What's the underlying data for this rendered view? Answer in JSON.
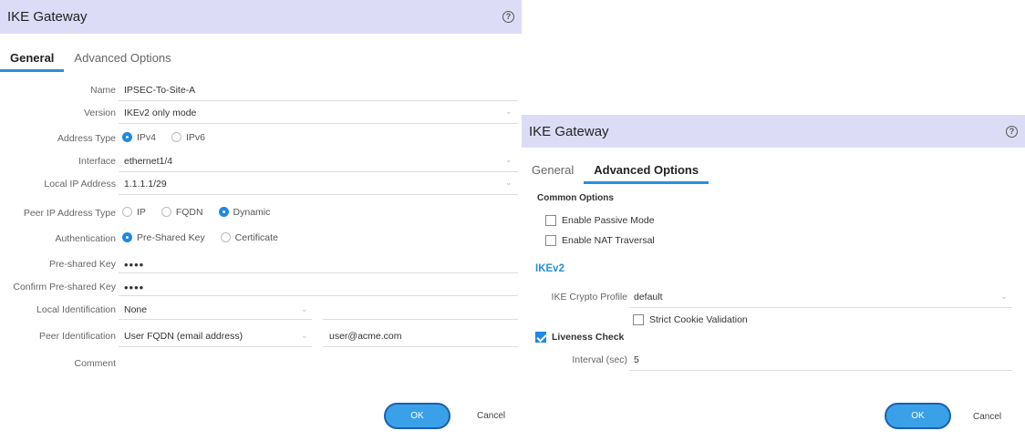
{
  "dialog1": {
    "title": "IKE Gateway",
    "help_symbol": "?",
    "tabs": [
      "General",
      "Advanced Options"
    ],
    "active_tab": "General",
    "fields": {
      "name": {
        "label": "Name",
        "value": "IPSEC-To-Site-A"
      },
      "version": {
        "label": "Version",
        "value": "IKEv2 only mode"
      },
      "address_type": {
        "label": "Address Type",
        "options": [
          "IPv4",
          "IPv6"
        ],
        "selected": "IPv4"
      },
      "interface": {
        "label": "Interface",
        "value": "ethernet1/4"
      },
      "local_ip": {
        "label": "Local IP Address",
        "value": "1.1.1.1/29"
      },
      "peer_ip_type": {
        "label": "Peer IP Address Type",
        "options": [
          "IP",
          "FQDN",
          "Dynamic"
        ],
        "selected": "Dynamic"
      },
      "authentication": {
        "label": "Authentication",
        "options": [
          "Pre-Shared Key",
          "Certificate"
        ],
        "selected": "Pre-Shared Key"
      },
      "psk": {
        "label": "Pre-shared Key",
        "value": "••••"
      },
      "confirm_psk": {
        "label": "Confirm Pre-shared Key",
        "value": "••••"
      },
      "local_id": {
        "label": "Local Identification",
        "value": "None",
        "extra": ""
      },
      "peer_id": {
        "label": "Peer Identification",
        "value": "User FQDN (email address)",
        "extra": "user@acme.com"
      },
      "comment": {
        "label": "Comment",
        "value": ""
      }
    },
    "ok_label": "OK",
    "cancel_label": "Cancel"
  },
  "dialog2": {
    "title": "IKE Gateway",
    "help_symbol": "?",
    "tabs": [
      "General",
      "Advanced Options"
    ],
    "active_tab": "Advanced Options",
    "common_options_label": "Common Options",
    "passive_mode": {
      "label": "Enable Passive Mode",
      "checked": false
    },
    "nat_traversal": {
      "label": "Enable NAT Traversal",
      "checked": false
    },
    "ikev2_label": "IKEv2",
    "crypto_profile": {
      "label": "IKE Crypto Profile",
      "value": "default"
    },
    "strict_cookie": {
      "label": "Strict Cookie Validation",
      "checked": false
    },
    "liveness": {
      "label": "Liveness Check",
      "checked": true
    },
    "interval": {
      "label": "Interval (sec)",
      "value": "5"
    },
    "ok_label": "OK",
    "cancel_label": "Cancel"
  },
  "colors": {
    "titlebar": "#dcdcf7",
    "accent": "#2a8fd9",
    "ok_button": "#3aa0e8"
  }
}
